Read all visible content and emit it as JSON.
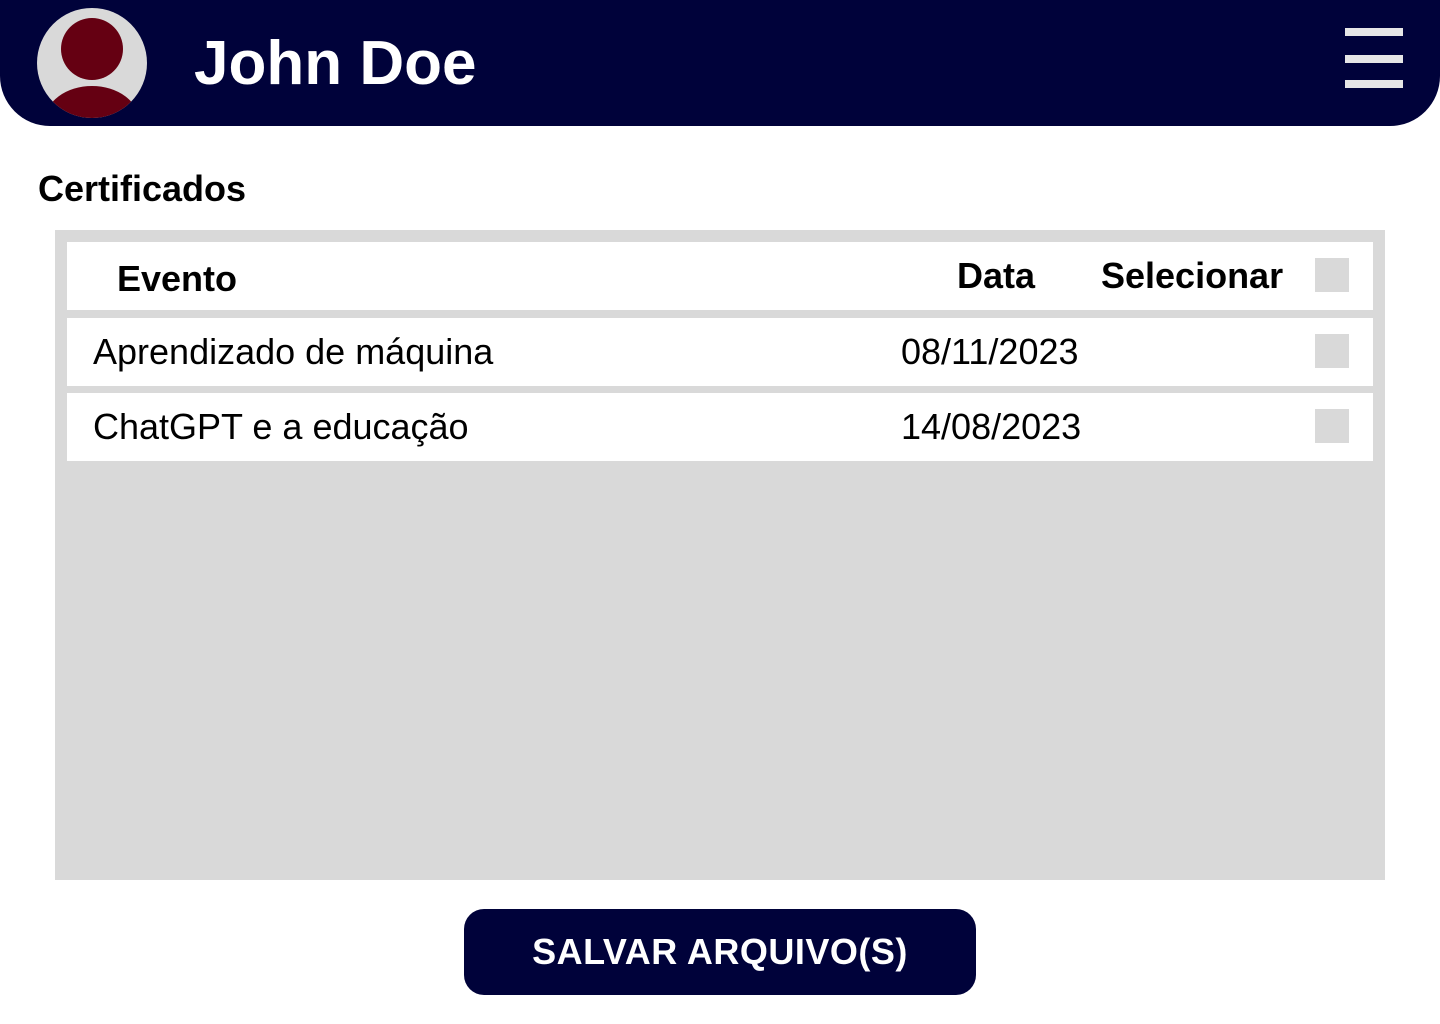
{
  "header": {
    "user_name": "John Doe",
    "avatar_icon": "user-avatar-icon",
    "menu_icon": "hamburger-menu-icon"
  },
  "section": {
    "title": "Certificados"
  },
  "table": {
    "columns": [
      "Evento",
      "Data",
      "Selecionar"
    ],
    "rows": [
      {
        "evento": "Aprendizado de máquina",
        "data": "08/11/2023",
        "selected": false
      },
      {
        "evento": "ChatGPT e a educação",
        "data": "14/08/2023",
        "selected": false
      }
    ]
  },
  "actions": {
    "save_label": "SALVAR ARQUIVO(S)"
  },
  "colors": {
    "primary": "#00023a",
    "avatar_accent": "#650012",
    "panel": "#d9d9d9"
  }
}
